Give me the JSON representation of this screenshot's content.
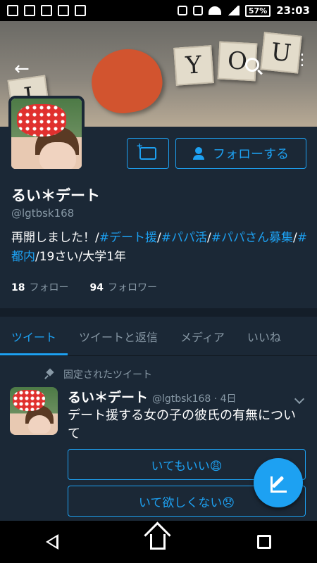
{
  "status_bar": {
    "battery": "57%",
    "time": "23:03"
  },
  "profile": {
    "name": "るい＊デート",
    "handle": "@lgtbsk168",
    "bio": {
      "p1": "再開しました！/",
      "tag1": "#デート援",
      "s1": "/",
      "tag2": "#パパ活",
      "s2": "/",
      "tag3": "#パパさん募集",
      "s3": "/",
      "tag4": "#都内",
      "p2": "/19さい/大学1年"
    },
    "following_count": "18",
    "following_label": "フォロー",
    "followers_count": "94",
    "followers_label": "フォロワー",
    "follow_button_label": "フォローする"
  },
  "tabs": [
    "ツイート",
    "ツイートと返信",
    "メディア",
    "いいね"
  ],
  "pinned_tweet": {
    "pinned_label": "固定されたツイート",
    "author_name": "るい＊デート",
    "meta": "@lgtbsk168 · 4日",
    "text": "デート援する女の子の彼氏の有無について",
    "poll_options": [
      "いてもいい😩",
      "いて欲しくない😞"
    ]
  },
  "colors": {
    "accent": "#1da1f2",
    "background": "#1b2836",
    "secondary_text": "#8899a6"
  }
}
